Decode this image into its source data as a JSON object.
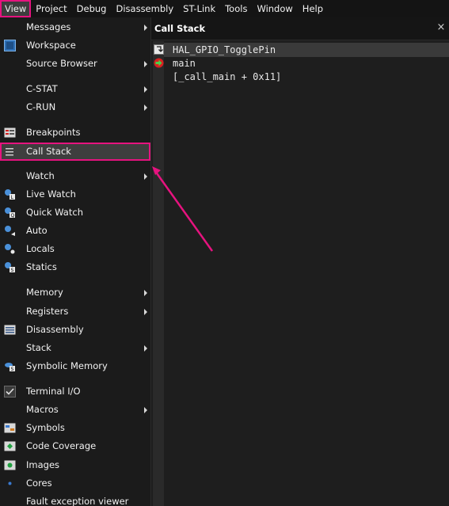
{
  "menubar": {
    "items": [
      {
        "label": "View"
      },
      {
        "label": "Project"
      },
      {
        "label": "Debug"
      },
      {
        "label": "Disassembly"
      },
      {
        "label": "ST-Link"
      },
      {
        "label": "Tools"
      },
      {
        "label": "Window"
      },
      {
        "label": "Help"
      }
    ]
  },
  "view_menu": {
    "items": [
      {
        "label": "Messages",
        "icon": "none",
        "submenu": true
      },
      {
        "label": "Workspace",
        "icon": "workspace-icon",
        "submenu": false
      },
      {
        "label": "Source Browser",
        "icon": "none",
        "submenu": true
      },
      {
        "label": "C-STAT",
        "icon": "none",
        "submenu": true
      },
      {
        "label": "C-RUN",
        "icon": "none",
        "submenu": true
      },
      {
        "label": "Breakpoints",
        "icon": "breakpoints-icon",
        "submenu": false
      },
      {
        "label": "Call Stack",
        "icon": "call-stack-icon",
        "submenu": false,
        "selected": true
      },
      {
        "label": "Watch",
        "icon": "none",
        "submenu": true
      },
      {
        "label": "Live Watch",
        "icon": "live-watch-icon",
        "submenu": false
      },
      {
        "label": "Quick Watch",
        "icon": "quick-watch-icon",
        "submenu": false
      },
      {
        "label": "Auto",
        "icon": "auto-icon",
        "submenu": false
      },
      {
        "label": "Locals",
        "icon": "locals-icon",
        "submenu": false
      },
      {
        "label": "Statics",
        "icon": "statics-icon",
        "submenu": false
      },
      {
        "label": "Memory",
        "icon": "none",
        "submenu": true
      },
      {
        "label": "Registers",
        "icon": "none",
        "submenu": true
      },
      {
        "label": "Disassembly",
        "icon": "disassembly-icon",
        "submenu": false
      },
      {
        "label": "Stack",
        "icon": "none",
        "submenu": true
      },
      {
        "label": "Symbolic Memory",
        "icon": "symbolic-memory-icon",
        "submenu": false
      },
      {
        "label": "Terminal I/O",
        "icon": "terminal-check-icon",
        "submenu": false
      },
      {
        "label": "Macros",
        "icon": "none",
        "submenu": true
      },
      {
        "label": "Symbols",
        "icon": "symbols-icon",
        "submenu": false
      },
      {
        "label": "Code Coverage",
        "icon": "code-coverage-icon",
        "submenu": false
      },
      {
        "label": "Images",
        "icon": "images-icon",
        "submenu": false
      },
      {
        "label": "Cores",
        "icon": "cores-icon",
        "submenu": false
      },
      {
        "label": "Fault exception viewer",
        "icon": "none",
        "submenu": false
      }
    ]
  },
  "call_stack": {
    "title": "Call Stack",
    "close_glyph": "×",
    "frames": [
      {
        "text": "HAL_GPIO_TogglePin",
        "icon": "current-frame-icon"
      },
      {
        "text": "main",
        "icon": "pc-arrow-icon"
      },
      {
        "text": "[_call_main + 0x11]",
        "icon": "none"
      }
    ]
  },
  "colors": {
    "highlight": "#e6137f",
    "background": "#1f1f1f"
  }
}
